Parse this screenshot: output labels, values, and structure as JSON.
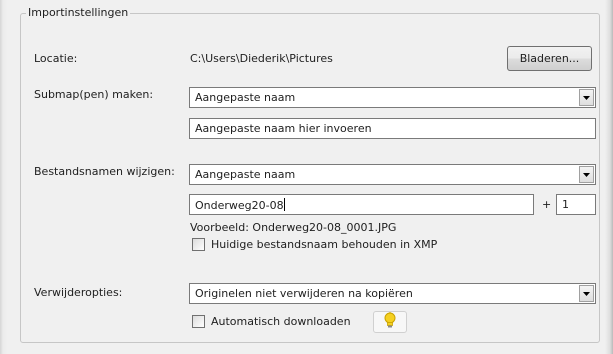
{
  "group": {
    "title": "Importinstellingen"
  },
  "location": {
    "label": "Locatie:",
    "path": "C:\\Users\\Diederik\\Pictures",
    "browse_label": "Bladeren..."
  },
  "subfolder": {
    "label": "Submap(pen) maken:",
    "selected": "Aangepaste naam",
    "custom_name": "Aangepaste naam hier invoeren"
  },
  "rename": {
    "label": "Bestandsnamen wijzigen:",
    "selected": "Aangepaste naam",
    "name_value": "Onderweg20-08",
    "plus": "+",
    "counter": "1",
    "example": "Voorbeeld: Onderweg20-08_0001.JPG",
    "keep_xmp_label": "Huidige bestandsnaam behouden in XMP"
  },
  "delete": {
    "label": "Verwijderopties:",
    "selected": "Originelen niet verwijderen na kopiëren",
    "auto_download_label": "Automatisch downloaden"
  },
  "icons": {
    "dropdown": "chevron-down-icon",
    "hint": "lightbulb-icon"
  },
  "colors": {
    "hint_yellow": "#f5d020",
    "border": "#7a7a7a"
  }
}
